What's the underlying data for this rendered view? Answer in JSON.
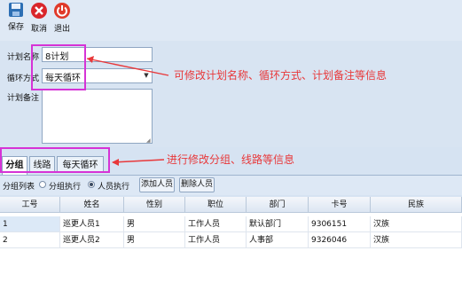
{
  "toolbar": {
    "save_label": "保存",
    "cancel_label": "取消",
    "exit_label": "退出",
    "colors": {
      "save": "#2d6fb4",
      "cancel": "#d9262b",
      "exit": "#e03a2a"
    }
  },
  "form": {
    "name_label": "计划名称",
    "name_value": "8计划",
    "cycle_label": "循环方式",
    "cycle_value": "每天循环",
    "note_label": "计划备注",
    "note_value": ""
  },
  "tabs": [
    {
      "label": "分组",
      "active": true
    },
    {
      "label": "线路",
      "active": false
    },
    {
      "label": "每天循环",
      "active": false
    }
  ],
  "group_bar": {
    "label": "分组列表",
    "radio_group_exec": "分组执行",
    "radio_person_exec": "人员执行",
    "selected": "人员执行",
    "add_button": "添加人员",
    "delete_button": "删除人员"
  },
  "grid": {
    "columns": [
      "工号",
      "姓名",
      "性别",
      "职位",
      "部门",
      "卡号",
      "民族"
    ],
    "rows": [
      [
        "1",
        "巡更人员1",
        "男",
        "工作人员",
        "默认部门",
        "9306151",
        "汉族"
      ],
      [
        "2",
        "巡更人员2",
        "男",
        "工作人员",
        "人事部",
        "9326046",
        "汉族"
      ]
    ]
  },
  "annotations": {
    "top": "可修改计划名称、循环方式、计划备注等信息",
    "bottom": "进行修改分组、线路等信息",
    "color": "#e8383a",
    "highlight_color": "#d633d6"
  }
}
